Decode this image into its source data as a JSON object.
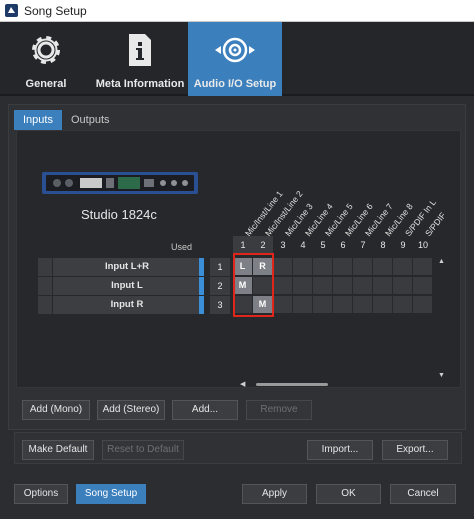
{
  "window": {
    "title": "Song Setup"
  },
  "tabs": [
    {
      "label": "General",
      "icon": "gear-icon",
      "active": false
    },
    {
      "label": "Meta Information",
      "icon": "info-document-icon",
      "active": false
    },
    {
      "label": "Audio I/O Setup",
      "icon": "speaker-io-icon",
      "active": true
    }
  ],
  "subtabs": [
    {
      "label": "Inputs",
      "active": true
    },
    {
      "label": "Outputs",
      "active": false
    }
  ],
  "device": {
    "name": "Studio 1824c"
  },
  "used_label": "Used",
  "columns": [
    "Mic/Inst/Line 1",
    "Mic/Inst/Line 2",
    "Mic/Line 3",
    "Mic/Line 4",
    "Mic/Line 5",
    "Mic/Line 6",
    "Mic/Line 7",
    "Mic/Line 8",
    "S/PDIF In L",
    "S/PDIF"
  ],
  "column_numbers": [
    "1",
    "2",
    "3",
    "4",
    "5",
    "6",
    "7",
    "8",
    "9",
    "10"
  ],
  "rows": [
    {
      "name": "Input L+R",
      "index": "1",
      "cells": [
        "L",
        "R",
        "",
        "",
        "",
        "",
        "",
        "",
        "",
        ""
      ]
    },
    {
      "name": "Input L",
      "index": "2",
      "cells": [
        "M",
        "",
        "",
        "",
        "",
        "",
        "",
        "",
        "",
        ""
      ]
    },
    {
      "name": "Input R",
      "index": "3",
      "cells": [
        "",
        "M",
        "",
        "",
        "",
        "",
        "",
        "",
        "",
        ""
      ]
    }
  ],
  "actions": {
    "add_mono": "Add (Mono)",
    "add_stereo": "Add (Stereo)",
    "add": "Add...",
    "remove": "Remove"
  },
  "defaults": {
    "make_default": "Make Default",
    "reset_default": "Reset to Default",
    "import": "Import...",
    "export": "Export..."
  },
  "footer": {
    "options": "Options",
    "song_setup": "Song Setup",
    "apply": "Apply",
    "ok": "OK",
    "cancel": "Cancel"
  },
  "colors": {
    "accent": "#3b7fbd",
    "highlight_box": "#e0261b",
    "background": "#2b2d30"
  }
}
